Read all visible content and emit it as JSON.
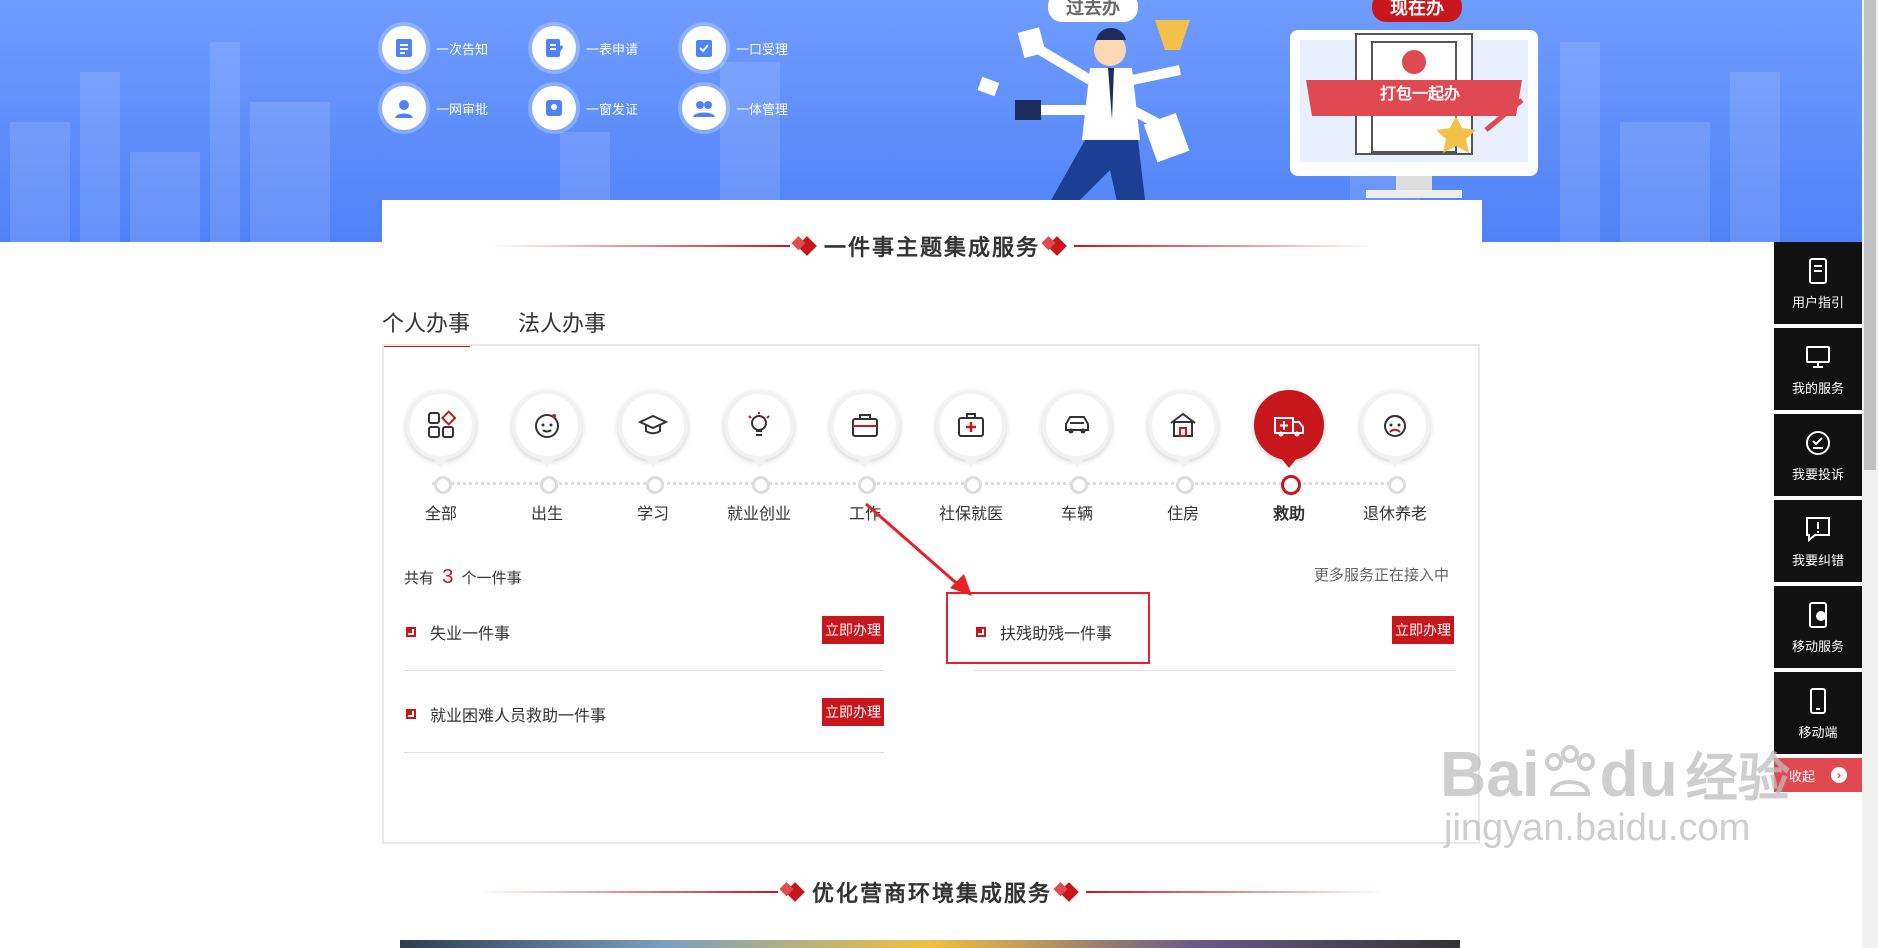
{
  "banner": {
    "steps": [
      {
        "label": "一次告知",
        "icon": "notice-icon"
      },
      {
        "label": "一表申请",
        "icon": "form-icon"
      },
      {
        "label": "一口受理",
        "icon": "accept-icon"
      },
      {
        "label": "一网审批",
        "icon": "user-icon"
      },
      {
        "label": "一窗发证",
        "icon": "certificate-icon"
      },
      {
        "label": "一体管理",
        "icon": "group-icon"
      }
    ],
    "past_tag": "过去办",
    "now_tag": "现在办",
    "package_label": "打包一起办"
  },
  "section1": {
    "title": "一件事主题集成服务"
  },
  "tabs": {
    "personal": "个人办事",
    "legal": "法人办事"
  },
  "categories": [
    {
      "label": "全部",
      "icon": "grid-icon",
      "active": false
    },
    {
      "label": "出生",
      "icon": "baby-icon",
      "active": false
    },
    {
      "label": "学习",
      "icon": "graduation-cap-icon",
      "active": false
    },
    {
      "label": "就业创业",
      "icon": "lightbulb-icon",
      "active": false
    },
    {
      "label": "工作",
      "icon": "briefcase-icon",
      "active": false
    },
    {
      "label": "社保就医",
      "icon": "medical-kit-icon",
      "active": false
    },
    {
      "label": "车辆",
      "icon": "car-icon",
      "active": false
    },
    {
      "label": "住房",
      "icon": "house-icon",
      "active": false
    },
    {
      "label": "救助",
      "icon": "ambulance-icon",
      "active": true
    },
    {
      "label": "退休养老",
      "icon": "elder-icon",
      "active": false
    }
  ],
  "summary": {
    "prefix": "共有",
    "count": "3",
    "suffix": "个一件事",
    "more": "更多服务正在接入中"
  },
  "services": [
    {
      "title": "失业一件事",
      "action": "立即办理"
    },
    {
      "title": "扶残助残一件事",
      "action": "立即办理"
    },
    {
      "title": "就业困难人员救助一件事",
      "action": "立即办理"
    }
  ],
  "section2": {
    "title": "优化营商环境集成服务"
  },
  "sidenav": {
    "items": [
      {
        "label": "用户指引",
        "icon": "guide-icon"
      },
      {
        "label": "我的服务",
        "icon": "monitor-icon"
      },
      {
        "label": "我要投诉",
        "icon": "complaint-icon"
      },
      {
        "label": "我要纠错",
        "icon": "error-report-icon"
      },
      {
        "label": "移动服务",
        "icon": "mobile-cloud-icon"
      },
      {
        "label": "移动端",
        "icon": "mobile-icon"
      }
    ],
    "collapse": "收起"
  },
  "watermark": {
    "brand": "Bai",
    "brand2": "du",
    "cn": "经验",
    "url": "jingyan.baidu.com"
  },
  "colors": {
    "accent": "#c8161d",
    "banner": "#4f82f6",
    "sidenav": "#111111",
    "collapse": "#e04952"
  }
}
